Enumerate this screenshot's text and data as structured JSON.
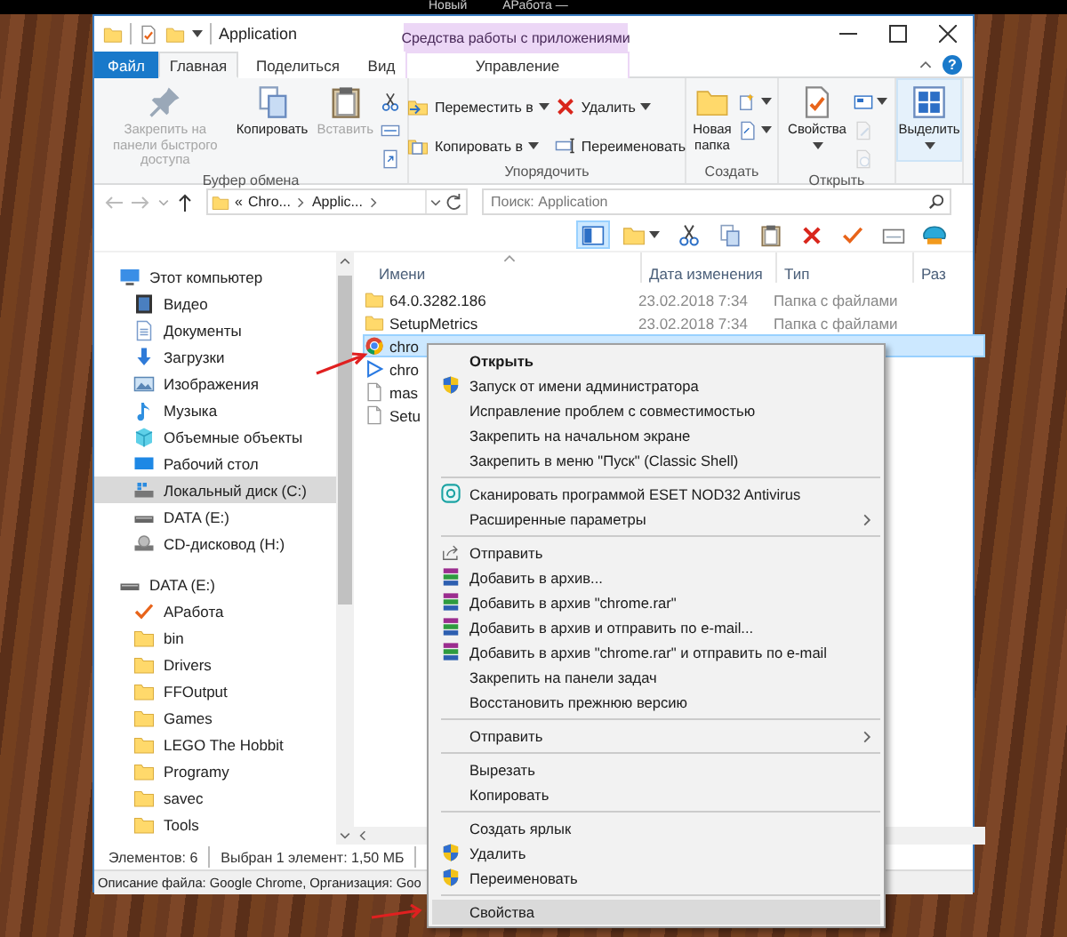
{
  "desktop": {
    "labels": [
      "Новый",
      "АРабота —"
    ]
  },
  "window": {
    "title": "Application",
    "contextual_header": "Средства работы с приложениями",
    "help_button": "?"
  },
  "tabs": [
    {
      "label": "Файл",
      "kind": "file",
      "selected": false
    },
    {
      "label": "Главная",
      "kind": "tab",
      "selected": true
    },
    {
      "label": "Поделиться",
      "kind": "tab",
      "selected": false
    },
    {
      "label": "Вид",
      "kind": "tab",
      "selected": false
    },
    {
      "label": "Управление",
      "kind": "contextual",
      "selected": false
    }
  ],
  "ribbon": {
    "groups": [
      {
        "label": "Буфер обмена",
        "highlighted": false,
        "columns": [
          [
            {
              "kind": "large",
              "label": "Закрепить на панели быстрого доступа",
              "disabled": true,
              "dropdown": false
            }
          ],
          [
            {
              "kind": "large",
              "label": "Копировать",
              "disabled": false,
              "dropdown": false
            }
          ],
          [
            {
              "kind": "large",
              "label": "Вставить",
              "disabled": true,
              "dropdown": false
            }
          ],
          [
            {
              "kind": "icon",
              "disabled": false,
              "dropdown": false
            },
            {
              "kind": "icon",
              "disabled": false,
              "dropdown": false
            },
            {
              "kind": "icon",
              "disabled": false,
              "dropdown": false
            }
          ]
        ]
      },
      {
        "label": "Упорядочить",
        "highlighted": false,
        "columns": [
          [
            {
              "kind": "small",
              "label": "Переместить в",
              "disabled": false,
              "dropdown": true
            },
            {
              "kind": "small",
              "label": "Копировать в",
              "disabled": false,
              "dropdown": true
            }
          ],
          [
            {
              "kind": "small",
              "label": "Удалить",
              "disabled": false,
              "dropdown": true
            },
            {
              "kind": "small",
              "label": "Переименовать",
              "disabled": false,
              "dropdown": false
            }
          ]
        ]
      },
      {
        "label": "Создать",
        "highlighted": false,
        "columns": [
          [
            {
              "kind": "large",
              "label": "Новая папка",
              "disabled": false,
              "dropdown": false
            }
          ],
          [
            {
              "kind": "icon",
              "disabled": false,
              "dropdown": true
            },
            {
              "kind": "icon",
              "disabled": false,
              "dropdown": true
            }
          ]
        ]
      },
      {
        "label": "Открыть",
        "highlighted": false,
        "columns": [
          [
            {
              "kind": "large",
              "label": "Свойства",
              "disabled": false,
              "dropdown": true
            }
          ],
          [
            {
              "kind": "icon",
              "disabled": false,
              "dropdown": true
            },
            {
              "kind": "icon",
              "disabled": true,
              "dropdown": false
            },
            {
              "kind": "icon",
              "disabled": true,
              "dropdown": false
            }
          ]
        ]
      },
      {
        "highlighted": true,
        "columns": [
          [
            {
              "kind": "large",
              "label": "Выделить",
              "disabled": false,
              "dropdown": true
            }
          ]
        ]
      }
    ]
  },
  "nav": {
    "back": {
      "disabled": true
    },
    "forward": {
      "disabled": true
    },
    "up": {
      "disabled": false
    }
  },
  "address": {
    "overflow": "«",
    "crumbs": [
      "Chro...",
      "Applic..."
    ]
  },
  "search": {
    "placeholder": "Поиск: Application"
  },
  "toolbar": {
    "preview_pane": {
      "on": true
    },
    "buttons": [
      {
        "kind": "pane"
      },
      {
        "kind": "newfolder"
      },
      {
        "kind": "cut"
      },
      {
        "kind": "copy"
      },
      {
        "kind": "paste"
      },
      {
        "kind": "delete"
      },
      {
        "kind": "check"
      },
      {
        "kind": "mail"
      },
      {
        "kind": "shell"
      }
    ]
  },
  "navigation": [
    {
      "label": "Этот компьютер",
      "kind": "computer",
      "selected": false,
      "children": [
        {
          "label": "Видео",
          "kind": "video",
          "selected": false
        },
        {
          "label": "Документы",
          "kind": "docs",
          "selected": false
        },
        {
          "label": "Загрузки",
          "kind": "downloads",
          "selected": false
        },
        {
          "label": "Изображения",
          "kind": "images",
          "selected": false
        },
        {
          "label": "Музыка",
          "kind": "music",
          "selected": false
        },
        {
          "label": "Объемные объекты",
          "kind": "objects3d",
          "selected": false
        },
        {
          "label": "Рабочий стол",
          "kind": "desktop",
          "selected": false
        },
        {
          "label": "Локальный диск (C:)",
          "kind": "disk",
          "selected": true
        },
        {
          "label": "DATA (E:)",
          "kind": "drive",
          "selected": false
        },
        {
          "label": "CD-дисковод (H:)",
          "kind": "cd",
          "selected": false
        }
      ]
    },
    {
      "label": "DATA (E:)",
      "kind": "drive",
      "selected": false,
      "children": [
        {
          "label": "АРабота",
          "kind": "check",
          "selected": false
        },
        {
          "label": "bin",
          "kind": "folder",
          "selected": false
        },
        {
          "label": "Drivers",
          "kind": "folder",
          "selected": false
        },
        {
          "label": "FFOutput",
          "kind": "folder",
          "selected": false
        },
        {
          "label": "Games",
          "kind": "folder",
          "selected": false
        },
        {
          "label": "LEGO The Hobbit",
          "kind": "folder",
          "selected": false
        },
        {
          "label": "Programy",
          "kind": "folder",
          "selected": false
        },
        {
          "label": "savec",
          "kind": "folder",
          "selected": false
        },
        {
          "label": "Tools",
          "kind": "folder",
          "selected": false
        }
      ]
    }
  ],
  "files": {
    "columns": [
      {
        "label": "Имени",
        "sorted": true
      },
      {
        "label": "Дата изменения",
        "sorted": false
      },
      {
        "label": "Тип",
        "sorted": false
      },
      {
        "label": "Раз",
        "sorted": false
      }
    ],
    "rows": [
      {
        "kind": "folder",
        "name": "64.0.3282.186",
        "date": "23.02.2018 7:34",
        "type": "Папка с файлами",
        "selected": false
      },
      {
        "kind": "folder",
        "name": "SetupMetrics",
        "date": "23.02.2018 7:34",
        "type": "Папка с файлами",
        "selected": false
      },
      {
        "kind": "chrome",
        "name": "chro",
        "selected": true
      },
      {
        "kind": "play",
        "name": "chro",
        "selected": false
      },
      {
        "kind": "file",
        "name": "mas",
        "selected": false
      },
      {
        "kind": "file",
        "name": "Setu",
        "selected": false
      }
    ]
  },
  "status_bar": {
    "count": "Элементов: 6",
    "selection": "Выбран 1 элемент: 1,50 МБ"
  },
  "details_bar": {
    "text": "Описание файла: Google Chrome, Организация: Goo"
  },
  "context_menu": {
    "items": [
      {
        "kind": "plain",
        "label": "Открыть",
        "default": true,
        "submenu": false,
        "selected": false
      },
      {
        "kind": "shield",
        "label": "Запуск от имени администратора",
        "default": false,
        "submenu": false,
        "selected": false
      },
      {
        "kind": "plain",
        "label": "Исправление проблем с совместимостью",
        "default": false,
        "submenu": false,
        "selected": false
      },
      {
        "kind": "plain",
        "label": "Закрепить на начальном экране",
        "default": false,
        "submenu": false,
        "selected": false
      },
      {
        "kind": "plain",
        "label": "Закрепить в меню \"Пуск\" (Classic Shell)",
        "default": false,
        "submenu": false,
        "selected": false
      },
      {
        "kind": "separator"
      },
      {
        "kind": "eset",
        "label": "Сканировать программой ESET NOD32 Antivirus",
        "default": false,
        "submenu": false,
        "selected": false
      },
      {
        "kind": "plain",
        "label": "Расширенные параметры",
        "default": false,
        "submenu": true,
        "selected": false
      },
      {
        "kind": "separator"
      },
      {
        "kind": "share",
        "label": "Отправить",
        "default": false,
        "submenu": false,
        "selected": false
      },
      {
        "kind": "archive",
        "label": "Добавить в архив...",
        "default": false,
        "submenu": false,
        "selected": false
      },
      {
        "kind": "archive",
        "label": "Добавить в архив \"chrome.rar\"",
        "default": false,
        "submenu": false,
        "selected": false
      },
      {
        "kind": "archive",
        "label": "Добавить в архив и отправить по e-mail...",
        "default": false,
        "submenu": false,
        "selected": false
      },
      {
        "kind": "archive",
        "label": "Добавить в архив \"chrome.rar\" и отправить по e-mail",
        "default": false,
        "submenu": false,
        "selected": false
      },
      {
        "kind": "plain",
        "label": "Закрепить на панели задач",
        "default": false,
        "submenu": false,
        "selected": false
      },
      {
        "kind": "plain",
        "label": "Восстановить прежнюю версию",
        "default": false,
        "submenu": false,
        "selected": false
      },
      {
        "kind": "separator"
      },
      {
        "kind": "plain",
        "label": "Отправить",
        "default": false,
        "submenu": true,
        "selected": false
      },
      {
        "kind": "separator"
      },
      {
        "kind": "plain",
        "label": "Вырезать",
        "default": false,
        "submenu": false,
        "selected": false
      },
      {
        "kind": "plain",
        "label": "Копировать",
        "default": false,
        "submenu": false,
        "selected": false
      },
      {
        "kind": "separator"
      },
      {
        "kind": "plain",
        "label": "Создать ярлык",
        "default": false,
        "submenu": false,
        "selected": false
      },
      {
        "kind": "shield",
        "label": "Удалить",
        "default": false,
        "submenu": false,
        "selected": false
      },
      {
        "kind": "shield",
        "label": "Переименовать",
        "default": false,
        "submenu": false,
        "selected": false
      },
      {
        "kind": "separator"
      },
      {
        "kind": "plain",
        "label": "Свойства",
        "default": false,
        "submenu": false,
        "selected": true
      }
    ]
  }
}
